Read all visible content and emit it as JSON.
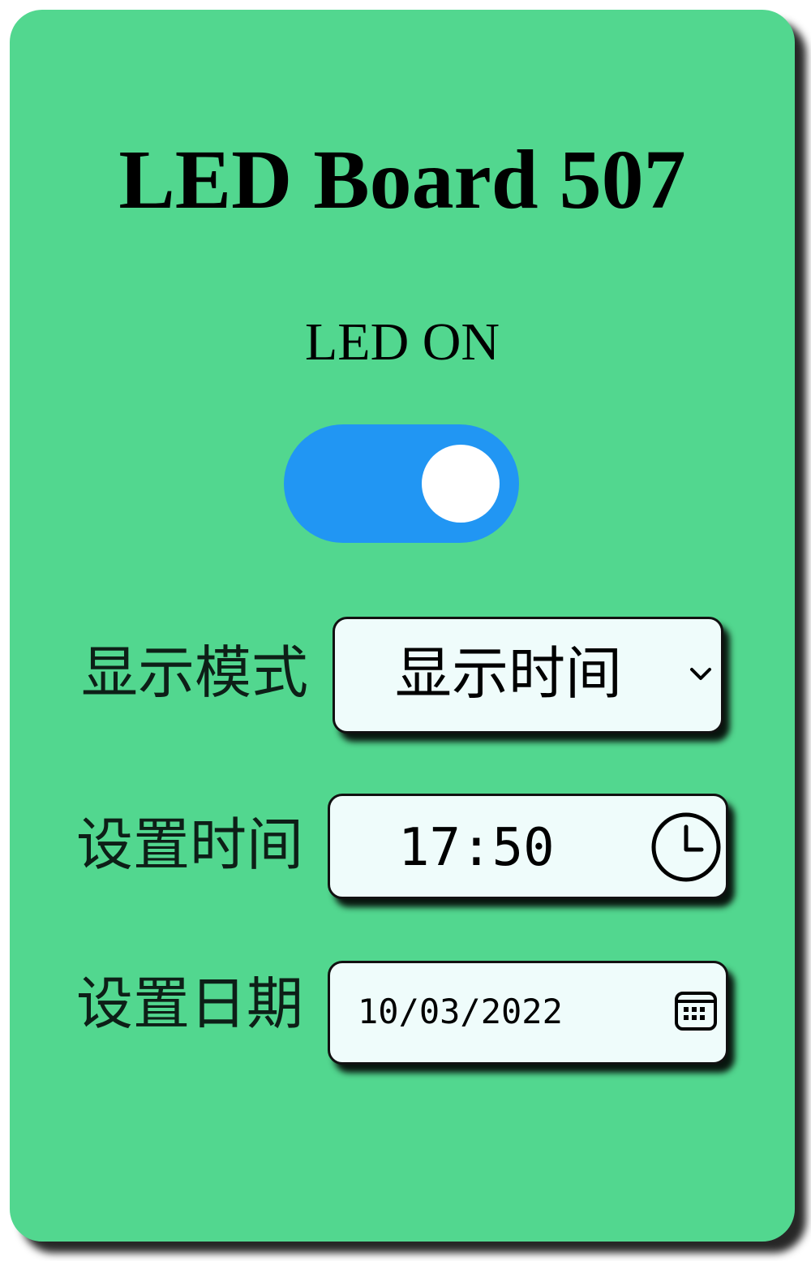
{
  "app": {
    "title": "LED Board 507",
    "status_text": "LED ON",
    "toggle": {
      "state": "on",
      "color": "#2196f3"
    }
  },
  "colors": {
    "card_background": "#52d78f",
    "field_background": "#effcfb"
  },
  "form": {
    "display_mode": {
      "label": "显示模式",
      "selected": "显示时间",
      "icon": "chevron-down-icon"
    },
    "set_time": {
      "label": "设置时间",
      "value": "17:50",
      "icon": "clock-icon"
    },
    "set_date": {
      "label": "设置日期",
      "value": "10/03/2022",
      "icon": "calendar-icon"
    }
  }
}
